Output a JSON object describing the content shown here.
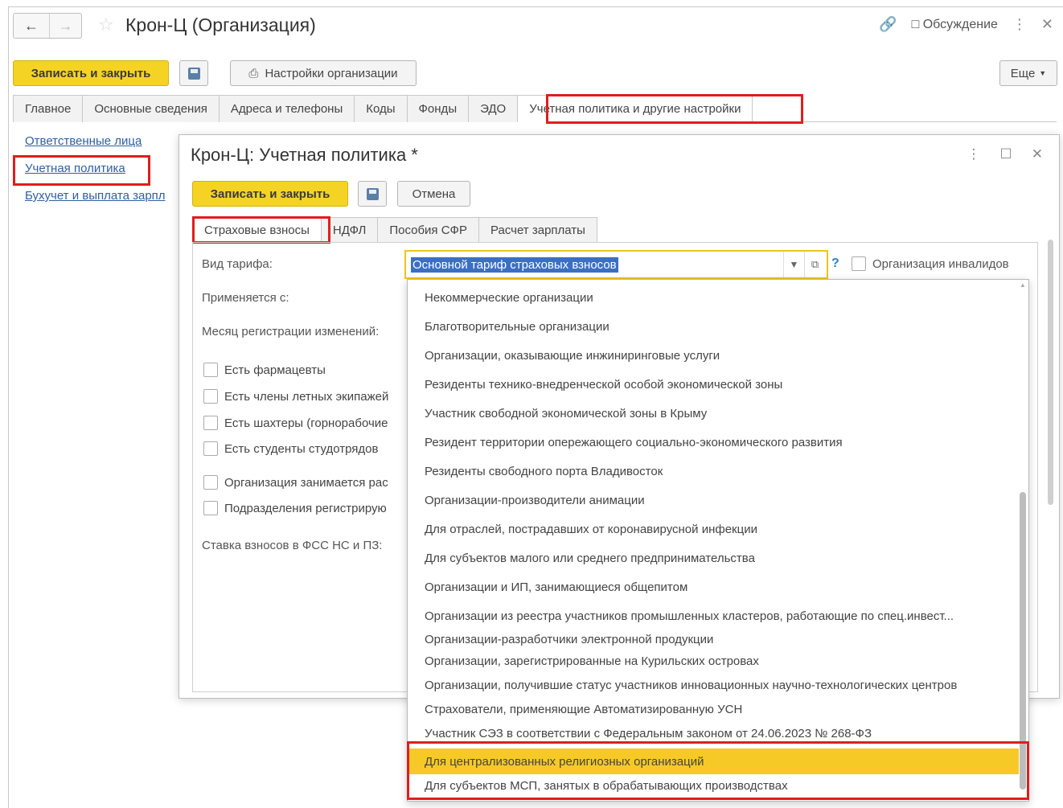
{
  "window": {
    "title": "Крон-Ц (Организация)",
    "discussion": "Обсуждение"
  },
  "toolbar": {
    "save_close": "Записать и закрыть",
    "org_settings": "Настройки организации",
    "more": "Еще"
  },
  "main_tabs": [
    "Главное",
    "Основные сведения",
    "Адреса и телефоны",
    "Коды",
    "Фонды",
    "ЭДО",
    "Учетная политика и другие настройки"
  ],
  "sidebar": {
    "items": [
      "Ответственные лица",
      "Учетная политика",
      "Бухучет и выплата зарпл"
    ]
  },
  "modal": {
    "title": "Крон-Ц: Учетная политика *",
    "save_close": "Записать и закрыть",
    "cancel": "Отмена",
    "tabs": [
      "Страховые взносы",
      "НДФЛ",
      "Пособия СФР",
      "Расчет зарплаты"
    ],
    "labels": {
      "tariff": "Вид тарифа:",
      "applies_from": "Применяется с:",
      "reg_month": "Месяц регистрации изменений:",
      "rate": "Ставка взносов в ФСС НС и ПЗ:"
    },
    "checkboxes": [
      "Есть фармацевты",
      "Есть члены летных экипажей",
      "Есть шахтеры (горнорабочие",
      "Есть студенты студотрядов",
      "Организация занимается рас",
      "Подразделения регистрирую"
    ],
    "tariff_value": "Основной тариф страховых взносов",
    "help": "?",
    "disabled_org": "Организация инвалидов"
  },
  "dropdown": {
    "items": [
      "Некоммерческие организации",
      "Благотворительные организации",
      "Организации, оказывающие инжиниринговые услуги",
      "Резиденты технико-внедренческой особой экономической зоны",
      "Участник свободной экономической зоны в Крыму",
      "Резидент территории опережающего социально-экономического развития",
      "Резиденты свободного порта Владивосток",
      "Организации-производители анимации",
      "Для отраслей, пострадавших от коронавирусной инфекции",
      "Для субъектов малого или среднего предпринимательства",
      "Организации и ИП, занимающиеся общепитом",
      "Организации из реестра участников промышленных кластеров, работающие по спец.инвест...",
      "Организации-разработчики электронной продукции",
      "Организации, зарегистрированные на Курильских островах",
      "Организации, получившие статус участников инновационных научно-технологических центров",
      "Страхователи, применяющие Автоматизированную УСН",
      "Участник СЭЗ в соответствии с Федеральным законом от 24.06.2023 № 268-ФЗ",
      "Для централизованных религиозных организаций",
      "Для субъектов МСП, занятых в обрабатывающих производствах"
    ],
    "selected_index": 17
  },
  "colors": {
    "accent_yellow": "#f5d325",
    "highlight_red": "#e01d1d",
    "selection_blue": "#3a6fc4",
    "link_blue": "#2f5fa0"
  }
}
